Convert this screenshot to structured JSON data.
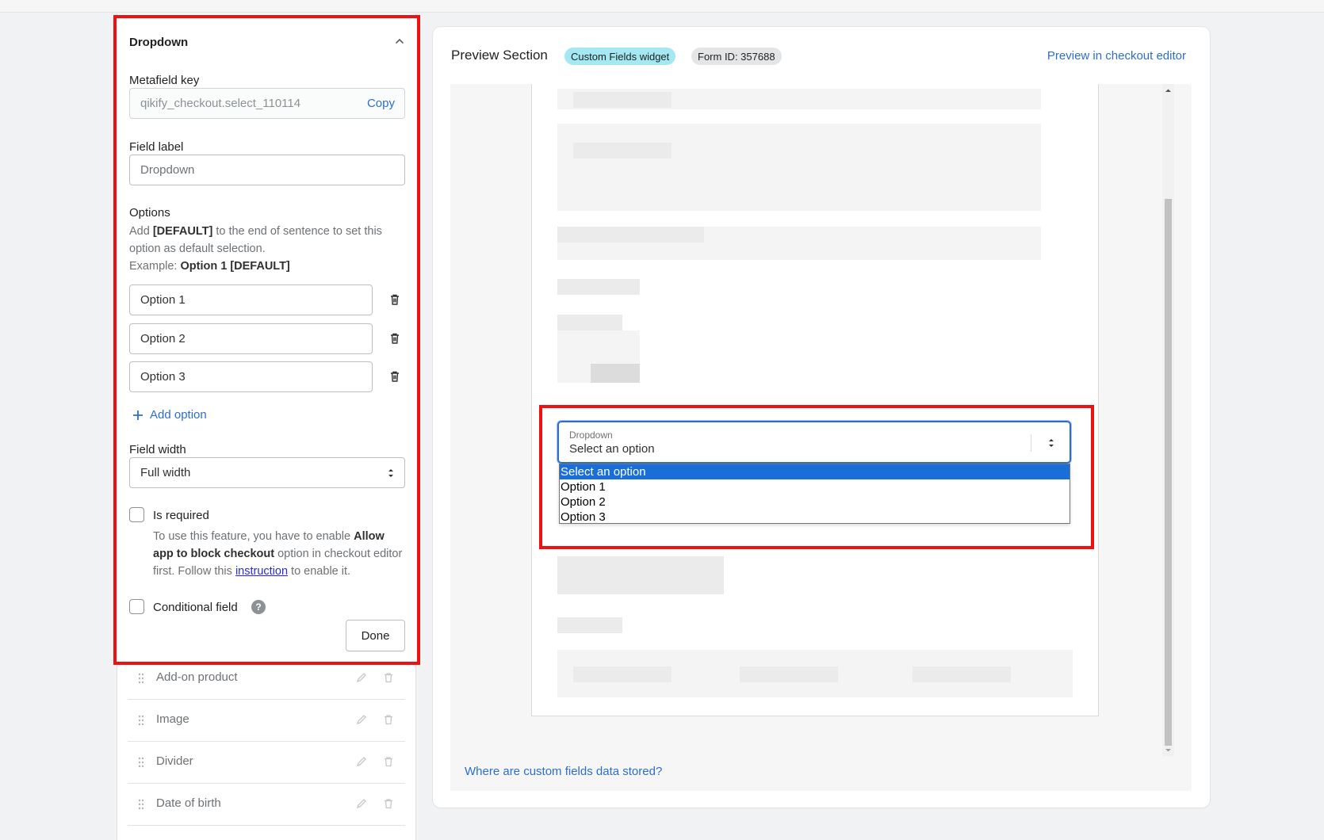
{
  "editor": {
    "title": "Dropdown",
    "metafield_label": "Metafield key",
    "metafield_value": "qikify_checkout.select_110114",
    "copy_label": "Copy",
    "field_label_label": "Field label",
    "field_label_placeholder": "Dropdown",
    "options_label": "Options",
    "options_help_1": "Add ",
    "options_help_default": "[DEFAULT]",
    "options_help_2": " to the end of sentence to set this option as default selection.",
    "options_example_prefix": "Example: ",
    "options_example_value": "Option 1 [DEFAULT]",
    "options": [
      "Option 1",
      "Option 2",
      "Option 3"
    ],
    "add_option_label": "Add option",
    "field_width_label": "Field width",
    "field_width_value": "Full width",
    "is_required_label": "Is required",
    "required_help_1": "To use this feature, you have to enable ",
    "required_help_bold": "Allow app to block checkout",
    "required_help_2": " option in checkout editor first. Follow this ",
    "required_help_link": "instruction",
    "required_help_3": " to enable it.",
    "conditional_label": "Conditional field",
    "help_glyph": "?",
    "done_label": "Done"
  },
  "field_list": [
    {
      "name": "Add-on product"
    },
    {
      "name": "Image"
    },
    {
      "name": "Divider"
    },
    {
      "name": "Date of birth"
    }
  ],
  "preview": {
    "title": "Preview Section",
    "badge_widget": "Custom Fields widget",
    "badge_form": "Form ID: 357688",
    "checkout_editor_link": "Preview in checkout editor",
    "select_label": "Dropdown",
    "select_value": "Select an option",
    "dropdown_items": [
      "Select an option",
      "Option 1",
      "Option 2",
      "Option 3"
    ],
    "footer_link": "Where are custom fields data stored?"
  },
  "colors": {
    "accent": "#2c6ecb",
    "highlight": "#ee1111",
    "badge_teal": "#a4e8f2",
    "dropdown_selected": "#1a6ed8"
  }
}
